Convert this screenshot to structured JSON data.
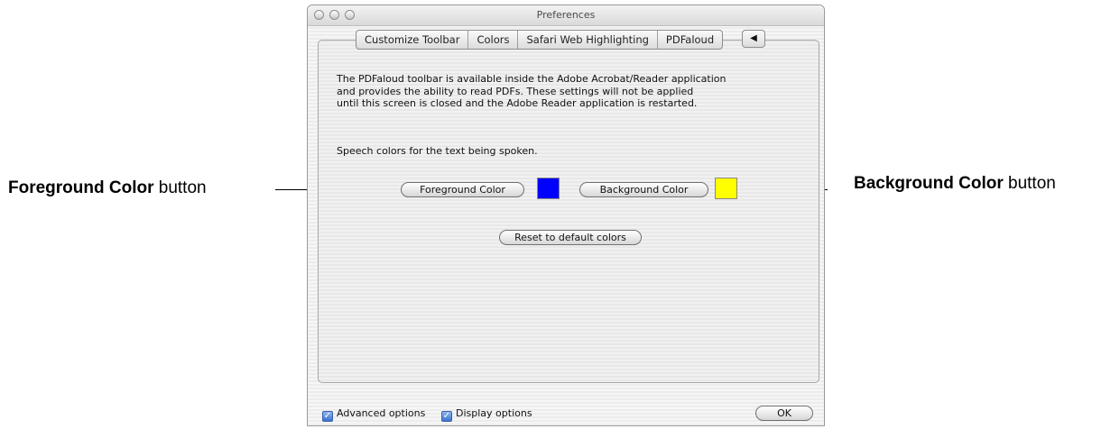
{
  "callouts": {
    "left": {
      "bold": "Foreground Color",
      "rest": " button"
    },
    "right": {
      "bold": "Background Color",
      "rest": " button"
    }
  },
  "window": {
    "title": "Preferences",
    "tabs": [
      "Customize Toolbar",
      "Colors",
      "Safari Web Highlighting",
      "PDFaloud"
    ],
    "tab_overflow_icon": "left-arrow-icon",
    "description": [
      "The PDFaloud toolbar is available inside the Adobe Acrobat/Reader application",
      "and provides the ability to read PDFs. These settings will not be applied",
      "until this screen is closed and the Adobe Reader application is restarted."
    ],
    "speech_label": "Speech colors for the text being spoken.",
    "foreground_button": "Foreground Color",
    "foreground_swatch_color": "#0000ff",
    "background_button": "Background Color",
    "background_swatch_color": "#ffff00",
    "reset_button": "Reset to default colors",
    "advanced_options": {
      "label": "Advanced options",
      "checked": true
    },
    "display_options": {
      "label": "Display options",
      "checked": true
    },
    "ok_button": "OK"
  }
}
